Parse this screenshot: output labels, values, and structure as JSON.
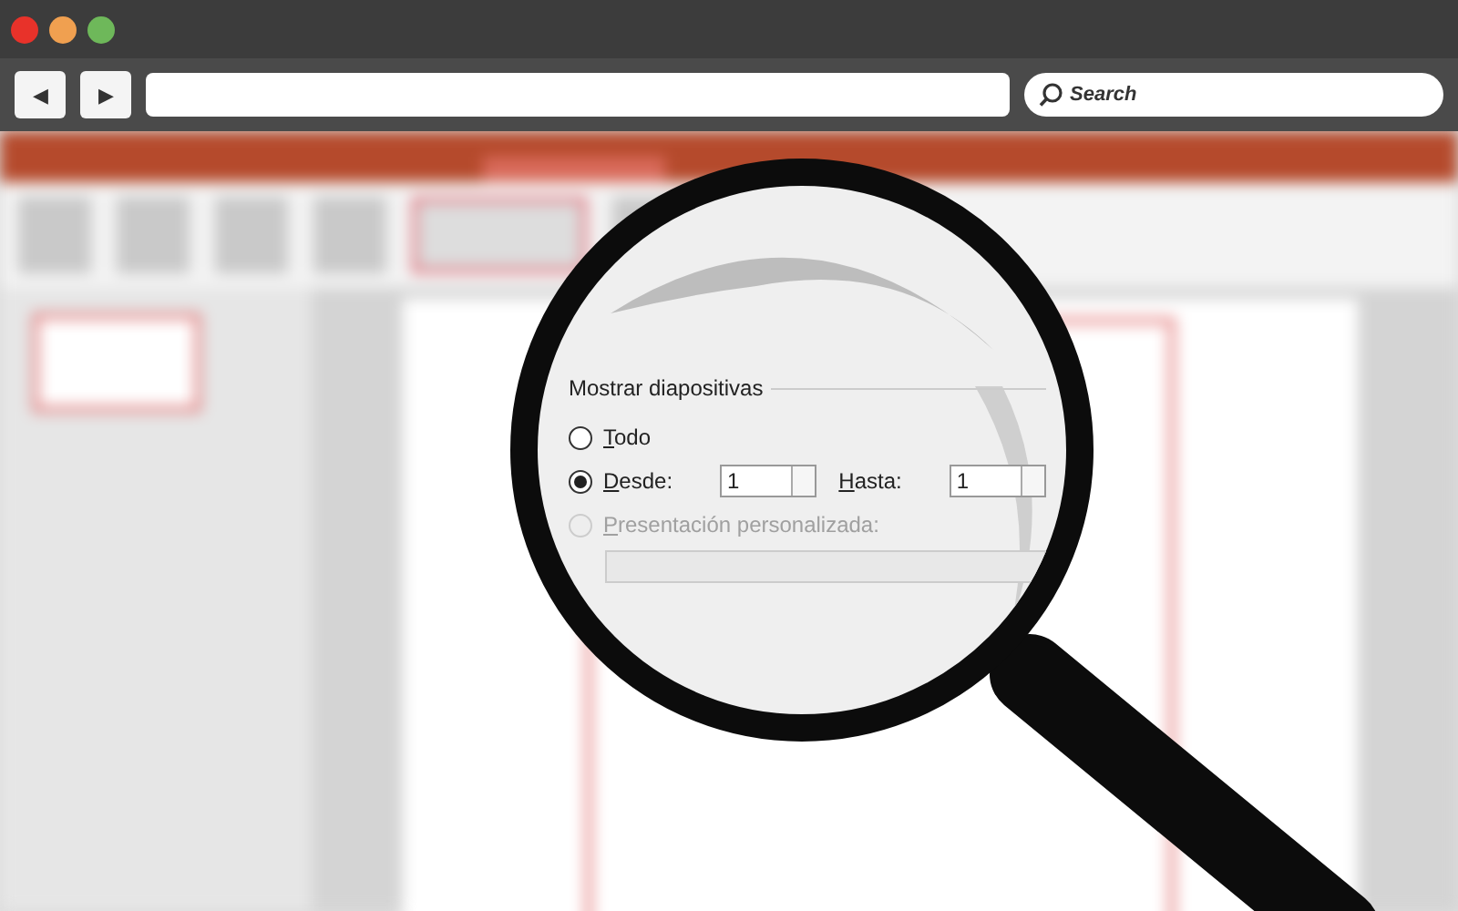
{
  "browser": {
    "back_button": "◀",
    "forward_button": "▶",
    "search": {
      "placeholder": "Search"
    }
  },
  "dialog": {
    "group_title": "Mostrar diapositivas",
    "options": [
      {
        "kind": "radio",
        "label": "Todo",
        "selected": false,
        "disabled": false
      },
      {
        "kind": "range",
        "label": "Desde:",
        "selected": true,
        "disabled": false,
        "from_value": "1",
        "to_label": "Hasta:",
        "to_value": "1"
      },
      {
        "kind": "dropdown",
        "label": "Presentación personalizada:",
        "selected": false,
        "disabled": true
      }
    ]
  }
}
